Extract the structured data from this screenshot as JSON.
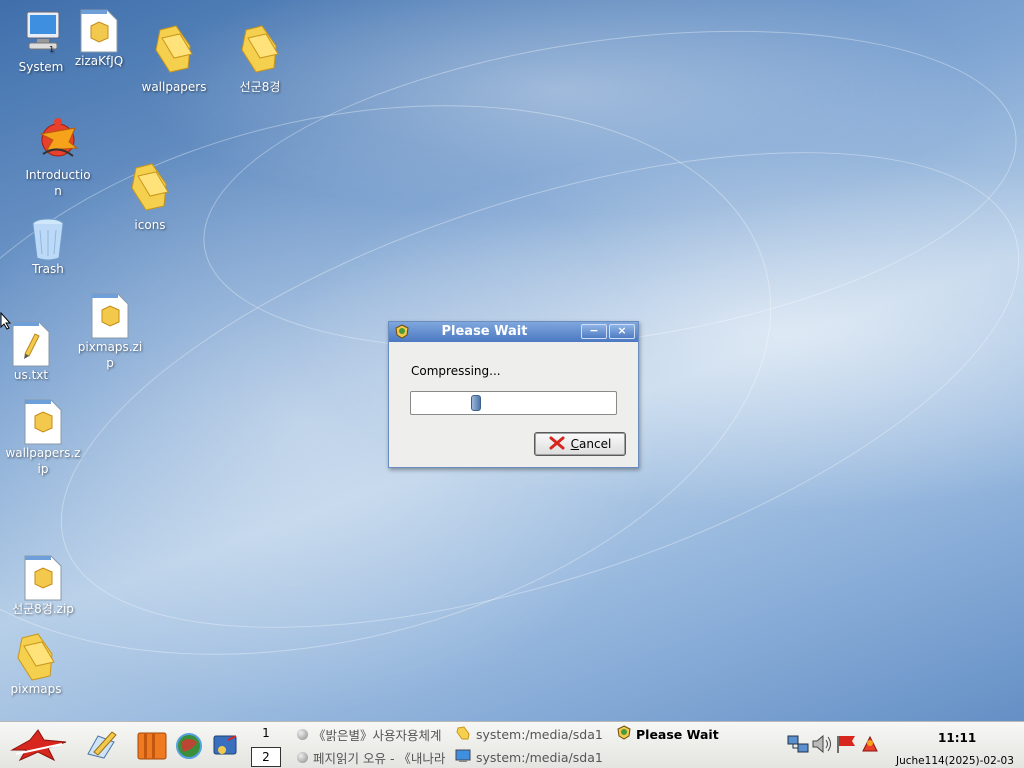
{
  "desktop": {
    "icons": [
      {
        "label": "System",
        "icon": "computer-icon"
      },
      {
        "label": "zizaKfJQ",
        "icon": "package-file-icon"
      },
      {
        "label": "wallpapers",
        "icon": "folder-icon"
      },
      {
        "label": "선군8경",
        "icon": "folder-icon"
      },
      {
        "label": "Introduction",
        "icon": "introduction-icon"
      },
      {
        "label": "icons",
        "icon": "folder-icon"
      },
      {
        "label": "Trash",
        "icon": "trash-icon"
      },
      {
        "label": "pixmaps.zip",
        "icon": "package-file-icon"
      },
      {
        "label": "us.txt",
        "icon": "text-file-icon"
      },
      {
        "label": "wallpapers.zip",
        "icon": "package-file-icon"
      },
      {
        "label": "선군8경.zip",
        "icon": "package-file-icon"
      },
      {
        "label": "pixmaps",
        "icon": "folder-icon"
      }
    ]
  },
  "dialog": {
    "title": "Please Wait",
    "message": "Compressing...",
    "progress_position": 0.3,
    "cancel_label": "Cancel",
    "minimize_label": "−",
    "close_label": "×"
  },
  "taskbar": {
    "pager": [
      "1",
      "2"
    ],
    "tasks": [
      {
        "label": "《밝은별》사용자용체계",
        "active": false
      },
      {
        "label": "system:/media/sda1",
        "active": false
      },
      {
        "label": "Please Wait",
        "active": true
      },
      {
        "label": "페지읽기 오유 - 《내나라",
        "active": false
      },
      {
        "label": "system:/media/sda1",
        "active": false
      }
    ],
    "clock": "11:11",
    "date": "Juche114(2025)-02-03"
  },
  "colors": {
    "titlebar": "#4b78c0",
    "folder": "#f2c94c",
    "accent_red": "#d7261e"
  }
}
